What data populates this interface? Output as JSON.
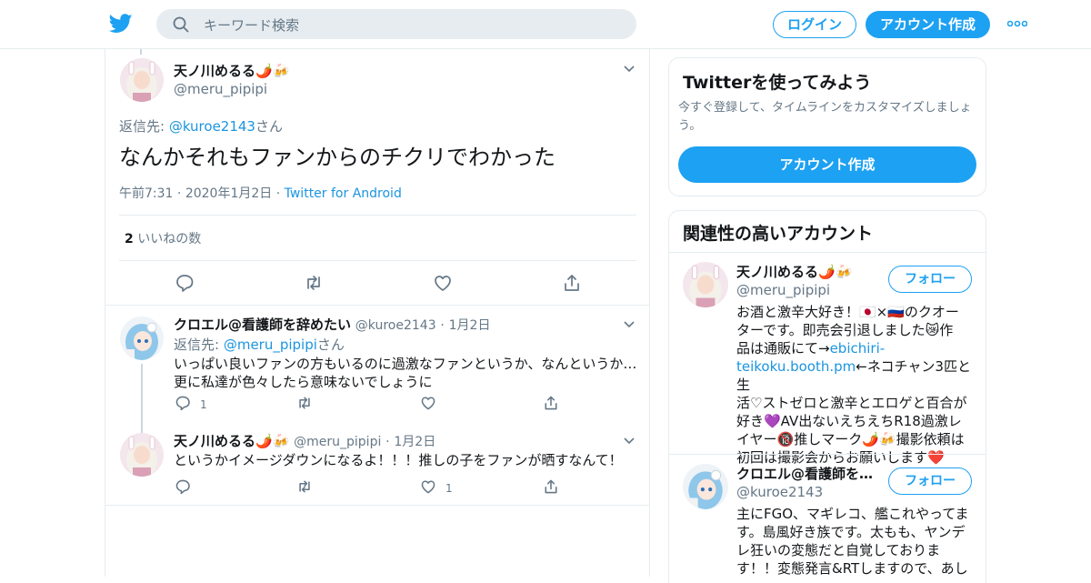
{
  "header": {
    "search_placeholder": "キーワード検索",
    "login_label": "ログイン",
    "signup_label": "アカウント作成"
  },
  "main_tweet": {
    "name": "天ノ川めるる🌶️🍻",
    "handle": "@meru_pipipi",
    "reply_prefix": "返信先: ",
    "reply_to": "@kuroe2143",
    "reply_suffix": "さん",
    "text": "なんかそれもファンからのチクリでわかった",
    "time": "午前7:31",
    "date": "2020年1月2日",
    "client": "Twitter for Android",
    "likes_count": "2",
    "likes_label": "いいねの数"
  },
  "replies": [
    {
      "name": "クロエル@看護師を辞めたい",
      "handle": "@kuroe2143",
      "date": "1月2日",
      "reply_prefix": "返信先: ",
      "reply_to": "@meru_pipipi",
      "reply_suffix": "さん",
      "text_line1": "いっぱい良いファンの方もいるのに過激なファンというか、なんというか…",
      "text_line2": "更に私達が色々したら意味ないでしょうに",
      "reply_count": "1",
      "retweet_count": "",
      "like_count": ""
    },
    {
      "name": "天ノ川めるる🌶️🍻",
      "handle": "@meru_pipipi",
      "date": "1月2日",
      "text_line1": "というかイメージダウンになるよ！！！推しの子をファンが晒すなんて！",
      "reply_count": "",
      "retweet_count": "",
      "like_count": "1"
    }
  ],
  "sidebar": {
    "signup_card": {
      "title": "Twitterを使ってみよう",
      "subtitle": "今すぐ登録して、タイムラインをカスタマイズしましょう。",
      "button": "アカウント作成"
    },
    "related": {
      "title": "関連性の高いアカウント",
      "follow_label": "フォロー",
      "accounts": [
        {
          "name": "天ノ川めるる🌶️🍻",
          "handle": "@meru_pipipi",
          "bio_lines": [
            "お酒と激辛大好き！🇯🇵×🇷🇺のクオー",
            "ターです。即売会引退しました😿作",
            "品は通販にて→",
            "teikoku.booth.pm",
            "活♡ストゼロと激辛とエロゲと百合が",
            "好き💜AV出ないえちえちR18過激レ",
            "イヤー🔞推しマーク🌶️🍻撮影依頼は",
            "初回は撮影会からお願いします❤️"
          ],
          "bio_link1": "ebichiri-",
          "bio_after_link": "←ネコチャン3匹と生"
        },
        {
          "name": "クロエル@看護師を…",
          "handle": "@kuroe2143",
          "bio_lines": [
            "主にFGO、マギレコ、艦これやってま",
            "す。島風好き族です。太もも、ヤンデ",
            "レ狂いの変態だと自覚しておりま",
            "す！！変態発言&RTしますので、あし"
          ]
        }
      ]
    }
  },
  "colors": {
    "accent": "#1da1f2",
    "link": "#1b95e0",
    "muted": "#657786",
    "border": "#e6ecf0"
  }
}
